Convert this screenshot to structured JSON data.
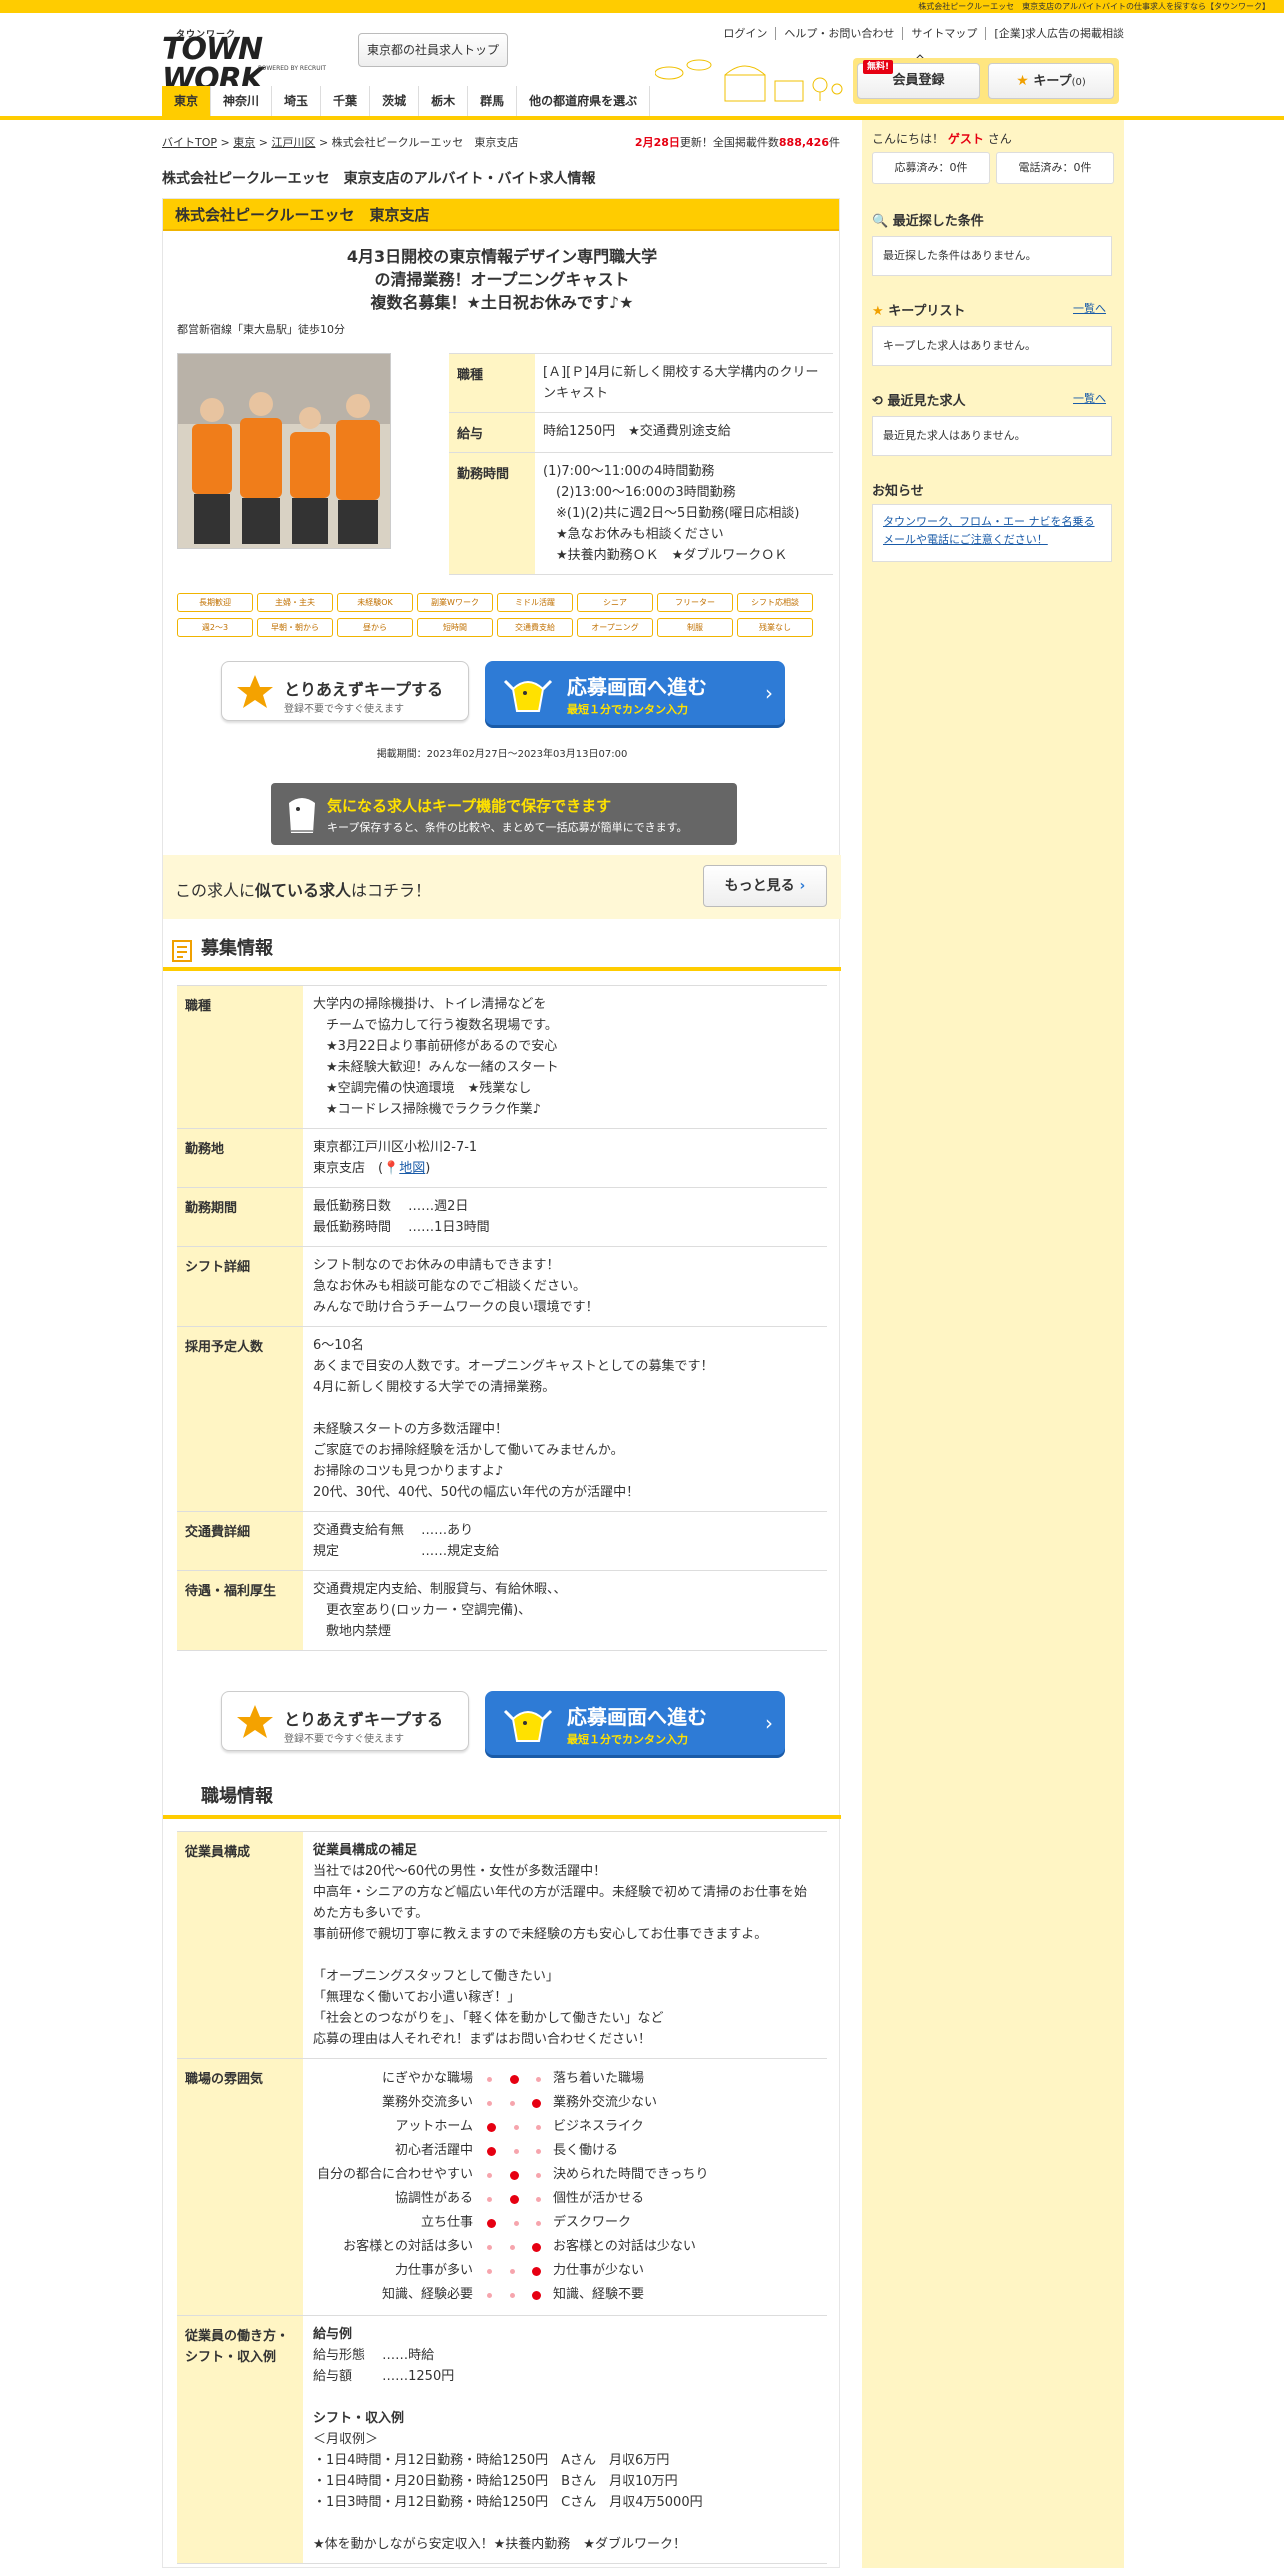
{
  "topbar": "株式会社ピークルーエッセ　東京支店のアルバイトバイトの仕事求人を探すなら【タウンワーク】",
  "header": {
    "logo_kana": "タウンワーク",
    "logo_main": "TOWN WORK",
    "logo_sub": "POWERED BY RECRUIT",
    "tokyo_button": "東京都の社員求人トップ",
    "links": [
      "ログイン",
      "ヘルプ・お問い合わせ",
      "サイトマップ",
      "[企業]求人広告の掲載相談"
    ],
    "member_button": "会員登録",
    "free_badge": "無料!",
    "keep_button": "キープ",
    "keep_count": "(0)"
  },
  "prefectures": [
    {
      "label": "東京",
      "active": true
    },
    {
      "label": "神奈川",
      "active": false
    },
    {
      "label": "埼玉",
      "active": false
    },
    {
      "label": "千葉",
      "active": false
    },
    {
      "label": "茨城",
      "active": false
    },
    {
      "label": "栃木",
      "active": false
    },
    {
      "label": "群馬",
      "active": false
    },
    {
      "label": "他の都道府県を選ぶ",
      "active": false
    }
  ],
  "breadcrumb": [
    "バイトTOP",
    "東京",
    "江戸川区",
    "株式会社ピークルーエッセ　東京支店"
  ],
  "updated": {
    "date": "2月28日",
    "text1": "更新！全国掲載件数",
    "count": "888,426",
    "unit": "件"
  },
  "page_title": "株式会社ピークルーエッセ　東京支店のアルバイト・バイト求人情報",
  "job": {
    "company": "株式会社ピークルーエッセ　東京支店",
    "catch1": "4月3日開校の東京情報デザイン専門職大学",
    "catch2": "の清掃業務！オープニングキャスト",
    "catch3": "複数名募集！★土日祝お休みです♪★",
    "station": "都営新宿線「東大島駅」徒歩10分",
    "summary": [
      {
        "label": "職種",
        "value": "[Ａ][Ｐ]4月に新しく開校する大学構内のクリーンキャスト"
      },
      {
        "label": "給与",
        "value": "時給1250円　★交通費別途支給"
      },
      {
        "label": "勤務時間",
        "value": "(1)7:00～11:00の4時間勤務\n　(2)13:00～16:00の3時間勤務\n　※(1)(2)共に週2日～5日勤務(曜日応相談)\n　★急なお休みも相談ください\n　★扶養内勤務ＯＫ　★ダブルワークＯＫ"
      }
    ],
    "tags": [
      "長期歓迎",
      "主婦・主夫",
      "未経験OK",
      "副業Wワーク",
      "ミドル活躍",
      "シニア",
      "フリーター",
      "シフト応相談",
      "週2～3",
      "早朝・朝から",
      "昼から",
      "短時間",
      "交通費支給",
      "オープニング",
      "制服",
      "残業なし"
    ],
    "keep_btn_title": "とりあえずキープする",
    "keep_btn_sub": "登録不要で今すぐ使えます",
    "apply_btn_title": "応募画面へ進む",
    "apply_btn_sub": "最短１分でカンタン入力",
    "period": "掲載期間：2023年02月27日～2023年03月13日07:00",
    "save_banner_title": "気になる求人はキープ機能で保存できます",
    "save_banner_sub": "キープ保存すると、条件の比較や、まとめて一括応募が簡単にできます。",
    "similar_pre": "この求人に",
    "similar_bold": "似ている求人",
    "similar_post": "はコチラ！",
    "similar_more": "もっと見る"
  },
  "recruit": {
    "title": "募集情報",
    "rows": [
      {
        "label": "職種",
        "value": "大学内の掃除機掛け、トイレ清掃などを\n　チームで協力して行う複数名現場です。\n　★3月22日より事前研修があるので安心\n　★未経験大歓迎！みんな一緒のスタート\n　★空調完備の快適環境　★残業なし\n　★コードレス掃除機でラクラク作業♪"
      },
      {
        "label": "勤務地",
        "value": "東京都江戸川区小松川2-7-1\n東京支店　(",
        "map": "地図",
        "close": ")"
      },
      {
        "label": "勤務期間",
        "value": "最低勤務日数　 ……週2日\n最低勤務時間　 ……1日3時間"
      },
      {
        "label": "シフト詳細",
        "value": "シフト制なのでお休みの申請もできます！\n急なお休みも相談可能なのでご相談ください。\nみんなで助け合うチームワークの良い環境です！"
      },
      {
        "label": "採用予定人数",
        "value": "6～10名\nあくまで目安の人数です。オープニングキャストとしての募集です！\n4月に新しく開校する大学での清掃業務。\n\n未経験スタートの方多数活躍中！\nご家庭でのお掃除経験を活かして働いてみませんか。\nお掃除のコツも見つかりますよ♪\n20代、30代、40代、50代の幅広い年代の方が活躍中！"
      },
      {
        "label": "交通費詳細",
        "value": "交通費支給有無　 ……あり\n規定　　　　　　 ……規定支給"
      },
      {
        "label": "待遇・福利厚生",
        "value": "交通費規定内支給、制服貸与、有給休暇、、\n　更衣室あり(ロッカー・空調完備)、\n　敷地内禁煙"
      }
    ]
  },
  "workplace": {
    "title": "職場情報",
    "staff_label": "従業員構成",
    "staff_sub": "従業員構成の補足",
    "staff_text": "当社では20代～60代の男性・女性が多数活躍中！\n中高年・シニアの方など幅広い年代の方が活躍中。未経験で初めて清掃のお仕事を始めた方も多いです。\n事前研修で親切丁寧に教えますので未経験の方も安心してお仕事できますよ。\n\n「オープニングスタッフとして働きたい」\n「無理なく働いてお小遣い稼ぎ！」\n「社会とのつながりを」、「軽く体を動かして働きたい」など\n応募の理由は人それぞれ！まずはお問い合わせください！",
    "atmosphere_label": "職場の雰囲気",
    "atmosphere": [
      {
        "left": "にぎやかな職場",
        "right": "落ち着いた職場",
        "level": 1
      },
      {
        "left": "業務外交流多い",
        "right": "業務外交流少ない",
        "level": 2
      },
      {
        "left": "アットホーム",
        "right": "ビジネスライク",
        "level": 0
      },
      {
        "left": "初心者活躍中",
        "right": "長く働ける",
        "level": 0
      },
      {
        "left": "自分の都合に合わせやすい",
        "right": "決められた時間できっちり",
        "level": 1
      },
      {
        "left": "協調性がある",
        "right": "個性が活かせる",
        "level": 1
      },
      {
        "left": "立ち仕事",
        "right": "デスクワーク",
        "level": 0
      },
      {
        "left": "お客様との対話は多い",
        "right": "お客様との対話は少ない",
        "level": 2
      },
      {
        "left": "力仕事が多い",
        "right": "力仕事が少ない",
        "level": 2
      },
      {
        "left": "知識、経験必要",
        "right": "知識、経験不要",
        "level": 2
      }
    ],
    "salary_label": "従業員の働き方・シフト・収入例",
    "salary_sub": "給与例",
    "salary_text": "給与形態　 ……時給\n給与額　　 ……1250円",
    "shift_sub": "シフト・収入例",
    "shift_text": "＜月収例＞\n・1日4時間・月12日勤務・時給1250円　Aさん　月収6万円\n・1日4時間・月20日勤務・時給1250円　Bさん　月収10万円\n・1日3時間・月12日勤務・時給1250円　Cさん　月収4万5000円\n\n★体を動かしながら安定収入！★扶養内勤務　★ダブルワーク！"
  },
  "sidebar": {
    "hello1": "こんにちは！",
    "guest": "ゲスト",
    "hello2": "さん",
    "applied": "応募済み：0件",
    "called": "電話済み：0件",
    "recent_search_title": "最近探した条件",
    "recent_search_empty": "最近探した条件はありません。",
    "keep_list_title": "キープリスト",
    "keep_list_more": "一覧へ",
    "keep_list_empty": "キープした求人はありません。",
    "recent_view_title": "最近見た求人",
    "recent_view_more": "一覧へ",
    "recent_view_empty": "最近見た求人はありません。",
    "notice_title": "お知らせ",
    "notice_text": "タウンワーク、フロム・エー ナビを名乗るメールや電話にご注意ください！"
  },
  "colors": {
    "brand": "#ffcc00",
    "accent": "#e60012",
    "apply": "#2e7bd6",
    "label_bg": "#fff5c4"
  }
}
